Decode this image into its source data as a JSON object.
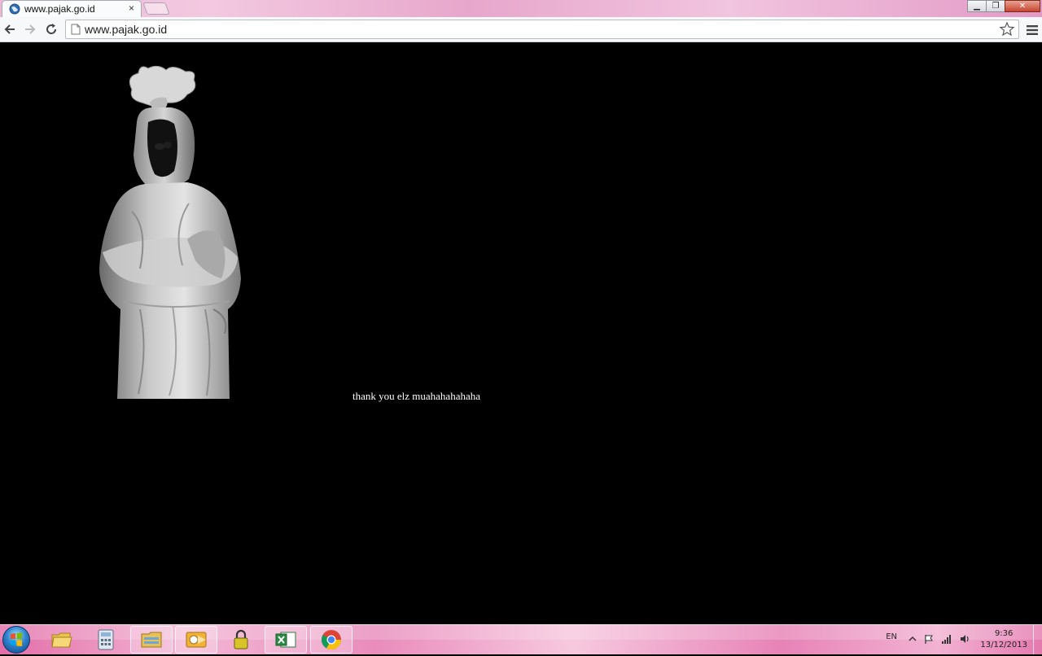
{
  "browser": {
    "tab": {
      "title": "www.pajak.go.id",
      "close_label": "×"
    },
    "address": {
      "url": "www.pajak.go.id"
    },
    "icons": {
      "favicon": "globe-icon",
      "back": "back-arrow-icon",
      "forward": "forward-arrow-icon",
      "reload": "reload-icon",
      "page": "page-icon",
      "bookmark": "star-icon",
      "menu": "menu-icon"
    },
    "window_controls": {
      "minimize": "▁",
      "maximize": "❐",
      "close": "✕"
    }
  },
  "page": {
    "message": "thank you elz muahahahahaha",
    "image": "ghost-figure-image"
  },
  "taskbar": {
    "start": "windows-start-icon",
    "apps": [
      {
        "name": "explorer-folder-icon"
      },
      {
        "name": "calculator-icon"
      },
      {
        "name": "file-cabinet-icon"
      },
      {
        "name": "outlook-icon"
      },
      {
        "name": "lock-folder-icon"
      },
      {
        "name": "excel-icon"
      },
      {
        "name": "chrome-icon"
      }
    ],
    "tray": {
      "language": "EN",
      "time": "9:36",
      "date": "13/12/2013"
    }
  }
}
